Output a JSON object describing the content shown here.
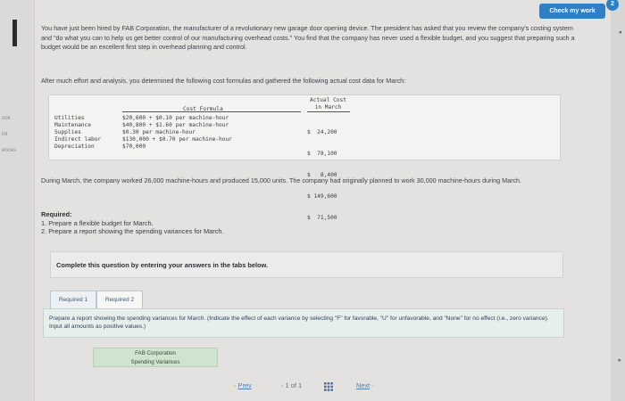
{
  "header": {
    "check_button": "Check my work",
    "badge": "2"
  },
  "left_rail": {
    "labels": [
      "ook",
      "int",
      "ences"
    ]
  },
  "problem": {
    "intro": "You have just been hired by FAB Corporation, the manufacturer of a revolutionary new garage door opening device. The president has asked that you review the company's costing system and \"do what you can to help us get better control of our manufacturing overhead costs.\" You find that the company has never used a flexible budget, and you suggest that preparing such a budget would be an excellent first step in overhead planning and control.",
    "analysis": "After much effort and analysis, you determined the following cost formulas and gathered the following actual cost data for March:",
    "table": {
      "formula_header": "Cost Formula",
      "actual_header_line1": "Actual Cost",
      "actual_header_line2": "in March",
      "items": [
        "Utilities",
        "Maintenance",
        "Supplies",
        "Indirect labor",
        "Depreciation"
      ],
      "formulas": [
        "$20,600 + $0.10 per machine-hour",
        "$40,800 + $1.60 per machine-hour",
        "$0.30 per machine-hour",
        "$130,000 + $0.70 per machine-hour",
        "$70,000"
      ],
      "actuals": [
        "$  24,200",
        "$  78,100",
        "$   8,400",
        "$ 149,600",
        "$  71,500"
      ]
    },
    "march_text": "During March, the company worked 26,000 machine-hours and produced 15,000 units. The company had originally planned to work 30,000 machine-hours during March.",
    "required_title": "Required:",
    "required_1": "1. Prepare a flexible budget for March.",
    "required_2": "2. Prepare a report showing the spending variances for March."
  },
  "instructions": "Complete this question by entering your answers in the tabs below.",
  "tabs": [
    {
      "label": "Required 1"
    },
    {
      "label": "Required 2"
    }
  ],
  "panel_text": "Prepare a report showing the spending variances for March. (Indicate the effect of each variance by selecting \"F\" for favorable, \"U\" for unfavorable, and \"None\" for no effect (i.e., zero variance). Input all amounts as positive values.)",
  "report": {
    "company": "FAB Corporation",
    "title": "Spending Variances"
  },
  "pagination": {
    "prev": "Prev",
    "current": "1",
    "of": "of",
    "total": "1",
    "next": "Next"
  }
}
